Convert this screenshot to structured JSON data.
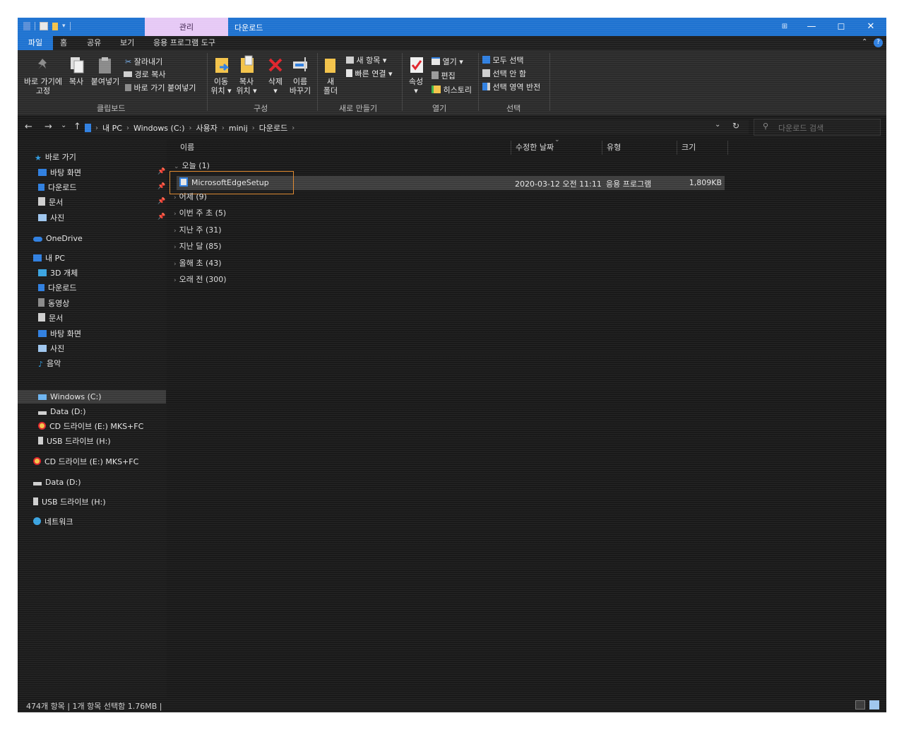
{
  "titlebar": {
    "context_tab": "관리",
    "title": "다운로드",
    "buttons": {
      "extra": "⊞",
      "minimize": "—",
      "maximize": "☐",
      "close": "✕"
    }
  },
  "ribbon_tabs": {
    "file": "파일",
    "home": "홈",
    "share": "공유",
    "view": "보기",
    "app_tools": "응용 프로그램 도구"
  },
  "ribbon": {
    "clipboard": {
      "pin_label": "바로 가기에\n고정",
      "copy": "복사",
      "paste": "붙여넣기",
      "cut": "잘라내기",
      "copy_path": "경로 복사",
      "paste_shortcut": "바로 가기 붙여넣기",
      "group": "클립보드"
    },
    "organize": {
      "move_to": "이동\n위치 ▾",
      "copy_to": "복사\n위치 ▾",
      "delete": "삭제\n▾",
      "rename": "이름\n바꾸기",
      "group": "구성"
    },
    "new": {
      "new_folder": "새\n폴더",
      "new_item": "새 항목 ▾",
      "easy_access": "빠른 연결 ▾",
      "group": "새로 만들기"
    },
    "open": {
      "properties": "속성\n▾",
      "open": "열기 ▾",
      "edit": "편집",
      "history": "히스토리",
      "group": "열기"
    },
    "select": {
      "select_all": "모두 선택",
      "select_none": "선택 안 함",
      "invert": "선택 영역 반전",
      "group": "선택"
    }
  },
  "address": {
    "back": "←",
    "forward": "→",
    "recent": "⌄",
    "up": "↑",
    "crumbs": [
      "내 PC",
      "Windows (C:)",
      "사용자",
      "minij",
      "다운로드"
    ],
    "search_placeholder": "다운로드 검색"
  },
  "nav": {
    "quick_access": "바로 가기",
    "qa_items": [
      "바탕 화면",
      "다운로드",
      "문서",
      "사진"
    ],
    "onedrive": "OneDrive",
    "this_pc": "내 PC",
    "pc_items": [
      "3D 개체",
      "다운로드",
      "동영상",
      "문서",
      "바탕 화면",
      "사진",
      "음악",
      "Windows (C:)",
      "Data (D:)",
      "CD 드라이브 (E:) MKS+FC",
      "USB 드라이브 (H:)"
    ],
    "cd_drive": "CD 드라이브 (E:) MKS+FC",
    "data_drive": "Data (D:)",
    "usb_drive": "USB 드라이브 (H:)",
    "network": "네트워크"
  },
  "columns": {
    "name": "이름",
    "modified": "수정한 날짜",
    "type": "유형",
    "size": "크기"
  },
  "groups": [
    {
      "label": "오늘 (1)",
      "expanded": true
    },
    {
      "label": "어제 (9)",
      "expanded": false
    },
    {
      "label": "이번 주 초 (5)",
      "expanded": false
    },
    {
      "label": "지난 주 (31)",
      "expanded": false
    },
    {
      "label": "지난 달 (85)",
      "expanded": false
    },
    {
      "label": "올해 초 (43)",
      "expanded": false
    },
    {
      "label": "오래 전 (300)",
      "expanded": false
    }
  ],
  "file": {
    "name": "MicrosoftEdgeSetup",
    "modified": "2020-03-12 오전 11:11",
    "type": "응용 프로그램",
    "size": "1,809KB"
  },
  "status": {
    "text": "474개 항목  |  1개 항목 선택함 1.76MB  |"
  },
  "colors": {
    "title_bar": "#1f73d1",
    "context_tab": "#e6c9f5",
    "focus_border": "#e0892f",
    "background": "#1a1a1a"
  }
}
